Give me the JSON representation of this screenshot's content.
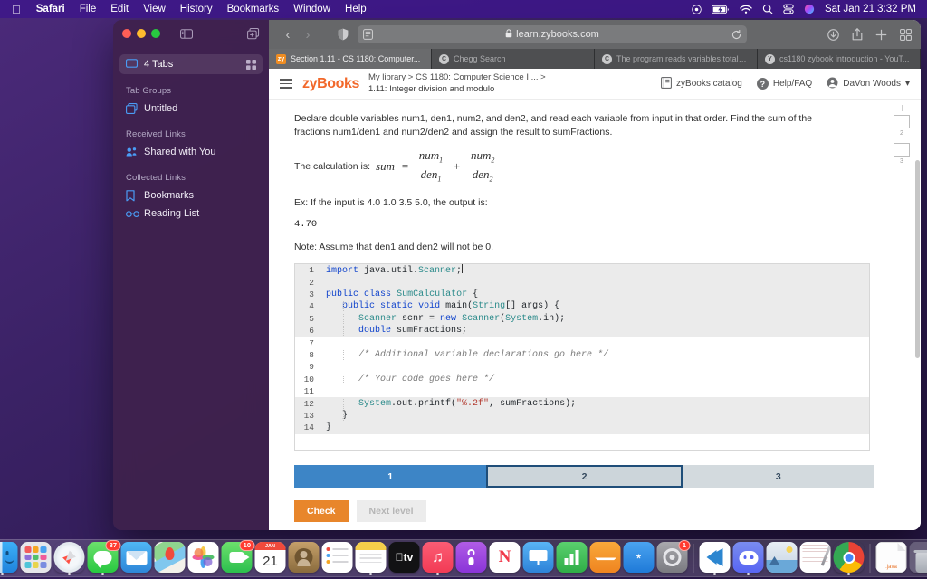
{
  "menubar": {
    "apple_icon": "apple-logo",
    "items": [
      "Safari",
      "File",
      "Edit",
      "View",
      "History",
      "Bookmarks",
      "Window",
      "Help"
    ],
    "right_icons": [
      "control-center-icon",
      "battery-icon",
      "wifi-icon",
      "spotlight-search-icon",
      "display-icon",
      "siri-icon"
    ],
    "clock": "Sat Jan 21  3:32 PM"
  },
  "sidebar": {
    "tabs_row": {
      "label": "4 Tabs",
      "left_icon": "tab-icon",
      "right_icon": "grid-icon"
    },
    "sections": [
      {
        "title": "Tab Groups",
        "items": [
          {
            "label": "Untitled",
            "icon": "tab-group-icon"
          }
        ]
      },
      {
        "title": "Received Links",
        "items": [
          {
            "label": "Shared with You",
            "icon": "shared-with-you-icon"
          }
        ]
      },
      {
        "title": "Collected Links",
        "items": [
          {
            "label": "Bookmarks",
            "icon": "bookmark-icon"
          },
          {
            "label": "Reading List",
            "icon": "glasses-icon"
          }
        ]
      }
    ]
  },
  "toolbar": {
    "back_icon": "chevron-left-icon",
    "forward_icon": "chevron-right-icon",
    "shield_icon": "privacy-shield-icon",
    "reader_icon": "reader-view-icon",
    "lock_icon": "lock-icon",
    "url": "learn.zybooks.com",
    "reload_icon": "reload-icon",
    "right_icons": [
      "downloads-icon",
      "share-icon",
      "new-tab-icon",
      "tab-overview-icon"
    ]
  },
  "tabs": [
    {
      "title": "Section 1.11 - CS 1180: Computer...",
      "favicon": "zy",
      "favicon_text": "zy",
      "active": true
    },
    {
      "title": "Chegg Search",
      "favicon": "chegg",
      "favicon_text": "C",
      "active": false
    },
    {
      "title": "The program reads variables totalV...",
      "favicon": "chegg",
      "favicon_text": "C",
      "active": false
    },
    {
      "title": "cs1180 zybook introduction - YouT...",
      "favicon": "yt",
      "favicon_text": "Y",
      "active": false
    }
  ],
  "zyheader": {
    "menu_icon": "hamburger-menu-icon",
    "logo": "zyBooks",
    "breadcrumb_line1": "My library > CS 1180: Computer Science I ... >",
    "breadcrumb_line2": "1.11: Integer division and modulo",
    "catalog_label": "zyBooks catalog",
    "catalog_icon": "book-icon",
    "help_label": "Help/FAQ",
    "help_icon": "question-circle-icon",
    "user_label": "DaVon Woods",
    "user_icon": "account-icon",
    "user_caret": "▾"
  },
  "content": {
    "paragraph1": "Declare double variables num1, den1, num2, and den2, and read each variable from input in that order. Find the sum of the fractions num1/den1 and num2/den2 and assign the result to sumFractions.",
    "calc_prefix": "The calculation is:",
    "math": {
      "sum_label": "sum",
      "equals": "=",
      "plus": "+",
      "frac1_num": "num",
      "frac1_num_sub": "1",
      "frac1_den": "den",
      "frac1_den_sub": "1",
      "frac2_num": "num",
      "frac2_num_sub": "2",
      "frac2_den": "den",
      "frac2_den_sub": "2"
    },
    "example_line": "Ex: If the input is 4.0 1.0 3.5 5.0, the output is:",
    "example_output": "4.70",
    "note_line": "Note: Assume that den1 and den2 will not be 0."
  },
  "code": {
    "lines": [
      {
        "n": "1",
        "locked": true,
        "text": "import java.util.Scanner;"
      },
      {
        "n": "2",
        "locked": true,
        "text": ""
      },
      {
        "n": "3",
        "locked": true,
        "text": "public class SumCalculator {"
      },
      {
        "n": "4",
        "locked": true,
        "text": "   public static void main(String[] args) {"
      },
      {
        "n": "5",
        "locked": true,
        "text": "      Scanner scnr = new Scanner(System.in);"
      },
      {
        "n": "6",
        "locked": true,
        "text": "      double sumFractions;"
      },
      {
        "n": "7",
        "locked": false,
        "text": ""
      },
      {
        "n": "8",
        "locked": false,
        "text": "      /* Additional variable declarations go here */"
      },
      {
        "n": "9",
        "locked": false,
        "text": ""
      },
      {
        "n": "10",
        "locked": false,
        "text": "      /* Your code goes here */"
      },
      {
        "n": "11",
        "locked": false,
        "text": ""
      },
      {
        "n": "12",
        "locked": true,
        "text": "      System.out.printf(\"%.2f\", sumFractions);"
      },
      {
        "n": "13",
        "locked": true,
        "text": "   }"
      },
      {
        "n": "14",
        "locked": true,
        "text": "}"
      }
    ]
  },
  "levels": [
    {
      "label": "1",
      "state": "done"
    },
    {
      "label": "2",
      "state": "current"
    },
    {
      "label": "3",
      "state": "todo"
    }
  ],
  "buttons": {
    "check": "Check",
    "next_level": "Next level"
  },
  "rail": {
    "markers": [
      {
        "num": "2"
      },
      {
        "num": "3"
      }
    ]
  },
  "colors": {
    "zybooks_orange": "#f2682a",
    "level_done_blue": "#3d85c6",
    "level_current_border": "#1f4e79",
    "check_button": "#e8862b",
    "sidebar_icon_blue": "#4a9cf5"
  },
  "dock": {
    "items": [
      {
        "name": "finder",
        "label": "Finder",
        "badge": null,
        "running": true
      },
      {
        "name": "launchpad",
        "label": "Launchpad",
        "badge": null,
        "running": false
      },
      {
        "name": "safari",
        "label": "Safari",
        "badge": null,
        "running": true
      },
      {
        "name": "messages",
        "label": "Messages",
        "badge": "87",
        "running": true
      },
      {
        "name": "mail",
        "label": "Mail",
        "badge": null,
        "running": false
      },
      {
        "name": "maps",
        "label": "Maps",
        "badge": null,
        "running": false
      },
      {
        "name": "photos",
        "label": "Photos",
        "badge": null,
        "running": false
      },
      {
        "name": "facetime",
        "label": "FaceTime",
        "badge": "10",
        "running": false
      },
      {
        "name": "calendar",
        "label": "Calendar",
        "badge": null,
        "running": false,
        "day": "21",
        "month": "JAN"
      },
      {
        "name": "contacts",
        "label": "Contacts",
        "badge": null,
        "running": false
      },
      {
        "name": "reminders",
        "label": "Reminders",
        "badge": null,
        "running": false
      },
      {
        "name": "notes",
        "label": "Notes",
        "badge": null,
        "running": true
      },
      {
        "name": "tv",
        "label": "TV",
        "badge": null,
        "running": false
      },
      {
        "name": "music",
        "label": "Music",
        "badge": null,
        "running": true
      },
      {
        "name": "podcasts",
        "label": "Podcasts",
        "badge": null,
        "running": false
      },
      {
        "name": "news",
        "label": "News",
        "badge": null,
        "running": false
      },
      {
        "name": "keynote",
        "label": "Keynote",
        "badge": null,
        "running": false
      },
      {
        "name": "numbers",
        "label": "Numbers",
        "badge": null,
        "running": false
      },
      {
        "name": "pages",
        "label": "Pages",
        "badge": null,
        "running": false
      },
      {
        "name": "app-store",
        "label": "App Store",
        "badge": null,
        "running": false
      },
      {
        "name": "system-settings",
        "label": "System Settings",
        "badge": "1",
        "running": false
      },
      {
        "name": "vs-code",
        "label": "Visual Studio Code",
        "badge": null,
        "running": true
      },
      {
        "name": "discord",
        "label": "Discord",
        "badge": null,
        "running": true
      },
      {
        "name": "preview",
        "label": "Preview",
        "badge": null,
        "running": false
      },
      {
        "name": "textedit",
        "label": "TextEdit",
        "badge": null,
        "running": false
      },
      {
        "name": "chrome",
        "label": "Google Chrome",
        "badge": null,
        "running": true
      },
      {
        "name": "java-file",
        "label": ".java",
        "badge": null,
        "running": false
      },
      {
        "name": "trash",
        "label": "Trash",
        "badge": null,
        "running": false
      }
    ]
  }
}
